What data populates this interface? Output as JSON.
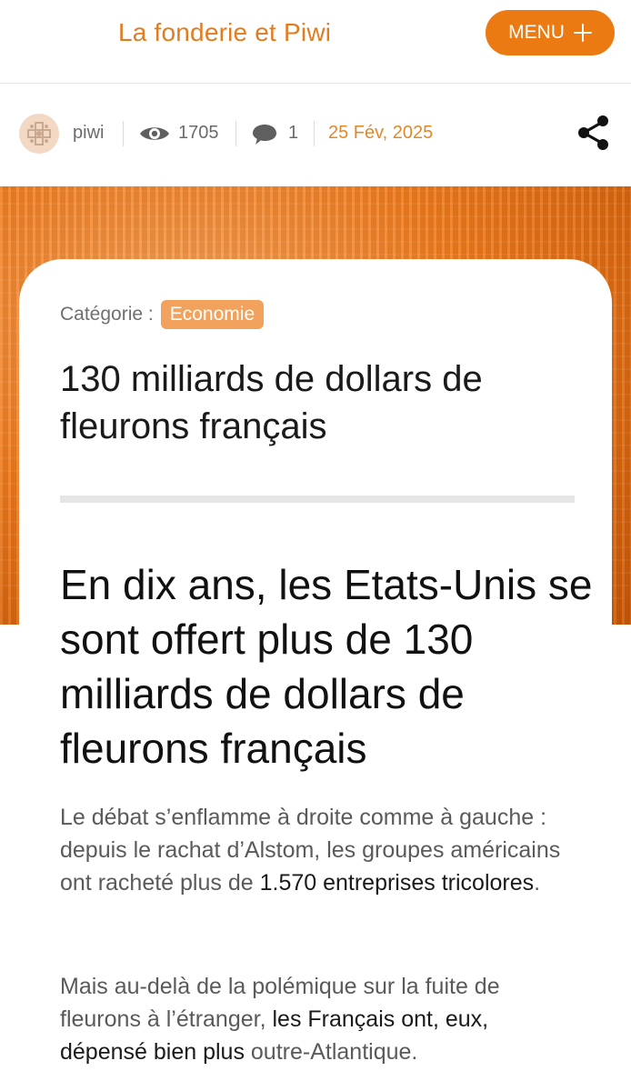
{
  "header": {
    "site_title": "La fonderie et Piwi",
    "menu_label": "MENU"
  },
  "meta": {
    "author": "piwi",
    "views": "1705",
    "comments": "1",
    "date": "25 Fév, 2025"
  },
  "article": {
    "category_label": "Catégorie :",
    "category": "Economie",
    "title": "130 milliards de dollars de fleurons français",
    "headline": "En dix ans, les Etats-Unis se sont offert plus de 130 milliards de dollars de fleurons français",
    "paragraph1": {
      "lead": "Le débat s’enflamme à droite comme à gauche : depuis le rachat d’Alstom, les groupes américains ont racheté plus de ",
      "strong": "1.570 entreprises tricolores",
      "tail": "."
    },
    "paragraph2": {
      "lead": "Mais au-delà de la polémique sur la fuite de fleurons à l’étranger, ",
      "strong": "les Français ont, eux, dépensé bien plus",
      "tail": " outre-Atlantique."
    }
  },
  "icons": {
    "avatar": "avatar-icon",
    "views": "eye-icon",
    "comments": "comment-icon",
    "share": "share-icon",
    "menu": "plus-icon"
  },
  "colors": {
    "brand": "#e07d22",
    "menu_bg": "#ec7a12",
    "pill_bg": "#f2a25c",
    "date": "#e0892c"
  }
}
